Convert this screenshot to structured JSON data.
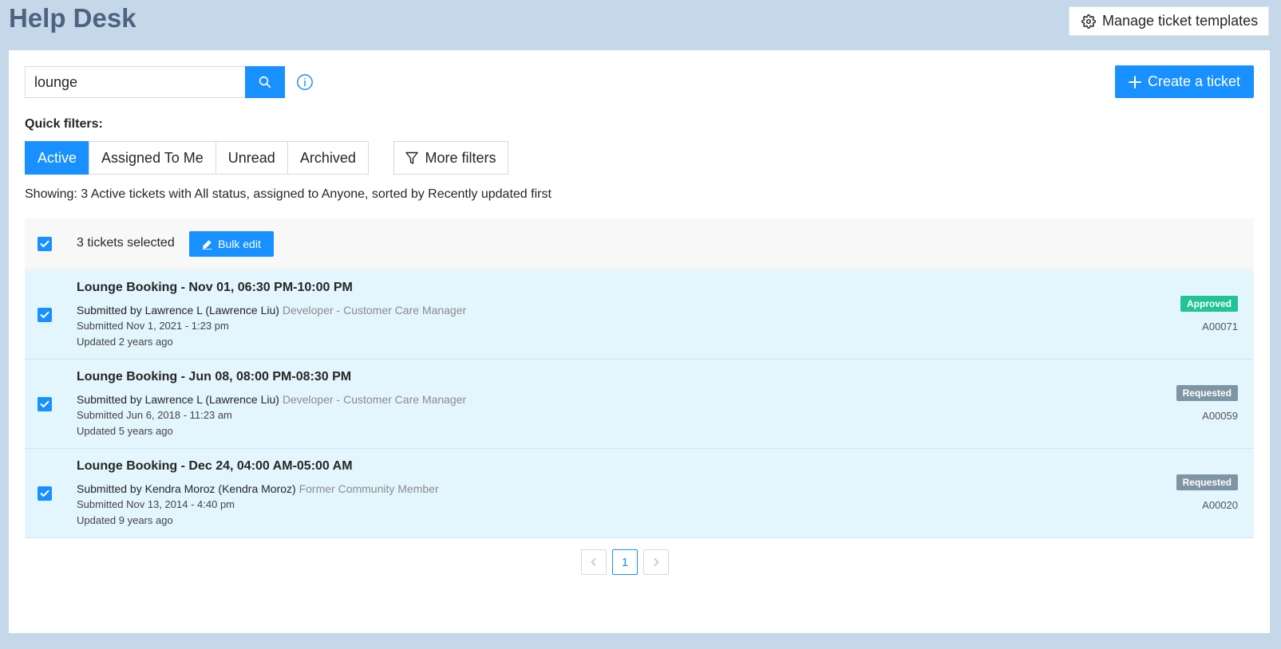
{
  "header": {
    "title": "Help Desk",
    "manage_templates_label": "Manage ticket templates"
  },
  "search": {
    "value": "lounge"
  },
  "create_ticket_label": "Create a ticket",
  "quick_filters": {
    "label": "Quick filters:",
    "options": [
      "Active",
      "Assigned To Me",
      "Unread",
      "Archived"
    ],
    "active": "Active",
    "more_filters_label": "More filters"
  },
  "showing_text": "Showing: 3 Active tickets with All status, assigned to Anyone, sorted by Recently updated first",
  "bulk": {
    "selected_text": "3 tickets selected",
    "edit_label": "Bulk edit"
  },
  "tickets": [
    {
      "title": "Lounge Booking - Nov 01, 06:30 PM-10:00 PM",
      "submitter": "Submitted by Lawrence L (Lawrence Liu)",
      "role": "Developer - Customer Care Manager",
      "submitted": "Submitted Nov 1, 2021 - 1:23 pm",
      "updated": "Updated 2 years ago",
      "status": "Approved",
      "status_color": "#22c497",
      "id": "A00071"
    },
    {
      "title": "Lounge Booking - Jun 08, 08:00 PM-08:30 PM",
      "submitter": "Submitted by Lawrence L (Lawrence Liu)",
      "role": "Developer - Customer Care Manager",
      "submitted": "Submitted Jun 6, 2018 - 11:23 am",
      "updated": "Updated 5 years ago",
      "status": "Requested",
      "status_color": "#7e96a3",
      "id": "A00059"
    },
    {
      "title": "Lounge Booking - Dec 24, 04:00 AM-05:00 AM",
      "submitter": "Submitted by Kendra Moroz (Kendra Moroz)",
      "role": "Former Community Member",
      "submitted": "Submitted Nov 13, 2014 - 4:40 pm",
      "updated": "Updated 9 years ago",
      "status": "Requested",
      "status_color": "#7e96a3",
      "id": "A00020"
    }
  ],
  "pagination": {
    "prev_icon": "chevron-left-icon",
    "current_page": "1",
    "next_icon": "chevron-right-icon"
  },
  "colors": {
    "accent": "#1890ff",
    "background": "#c5d8ea",
    "row_highlight": "#e3f5fd"
  }
}
